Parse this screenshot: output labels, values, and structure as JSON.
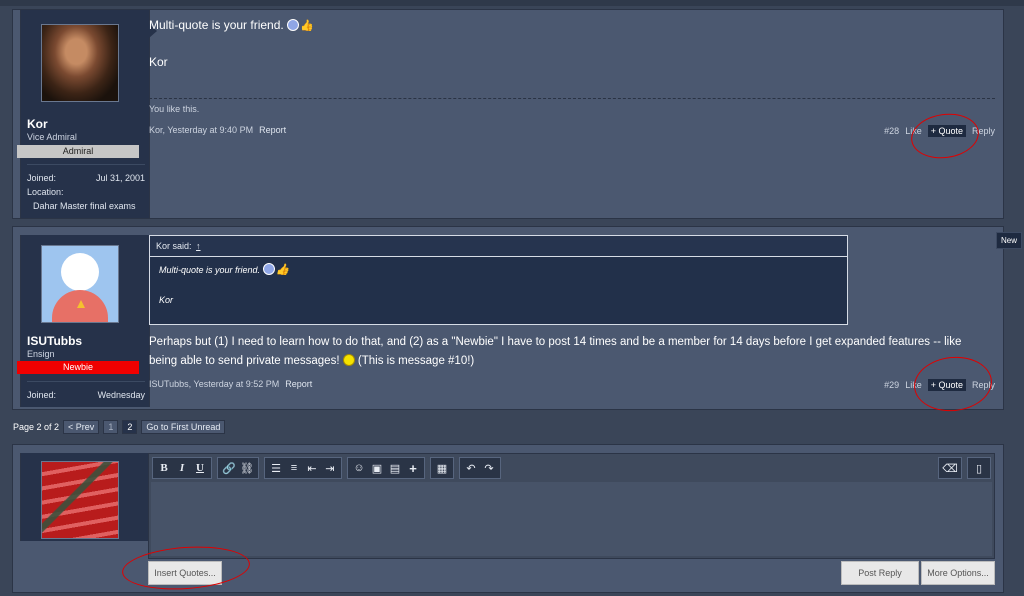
{
  "post28": {
    "username": "Kor",
    "title": "Vice Admiral",
    "banner": "Admiral",
    "joined_label": "Joined:",
    "joined_value": "Jul 31, 2001",
    "location_label": "Location:",
    "location_value": "Dahar Master final exams",
    "message_line1": "Multi-quote is your friend.",
    "message_line2": "Kor",
    "likes_text": "You like this.",
    "author_date": "Kor, Yesterday at 9:40 PM",
    "report": "Report",
    "number": "#28",
    "like": "Like",
    "quote": "+ Quote",
    "reply": "Reply"
  },
  "post29": {
    "username": "ISUTubbs",
    "title": "Ensign",
    "banner": "Newbie",
    "joined_label": "Joined:",
    "joined_value": "Wednesday",
    "quote_attribution": "Kor said:",
    "quote_up": "↑",
    "quote_line1": "Multi-quote is your friend.",
    "quote_line2": "Kor",
    "message_line1": "Perhaps but (1) I need to learn how to do that, and (2) as a \"Newbie\" I have to post 14 times and be a member for 14 days before I get expanded features -- like",
    "message_line2a": "being able to send private messages!",
    "message_line2b": "(This is message #10!)",
    "author_date": "ISUTubbs, Yesterday at 9:52 PM",
    "report": "Report",
    "number": "#29",
    "like": "Like",
    "quote": "+ Quote",
    "reply": "Reply",
    "new_tag": "New"
  },
  "pagenav": {
    "label": "Page 2 of 2",
    "prev": "< Prev",
    "page1": "1",
    "page2": "2",
    "first_unread": "Go to First Unread"
  },
  "editor": {
    "toolbar": {
      "bold": "B",
      "italic": "I",
      "underline": "U",
      "link": "🔗",
      "unlink": "⛓",
      "bullets": "☰",
      "numbers": "≡",
      "outdent": "⇤",
      "indent": "⇥",
      "smilies": "☺",
      "image": "▣",
      "media": "▤",
      "insert": "+",
      "save": "▦",
      "undo": "↶",
      "redo": "↷",
      "eraser": "⌫",
      "source": "▯"
    },
    "insert_quotes": "Insert Quotes...",
    "post_reply": "Post Reply",
    "more_options": "More Options..."
  }
}
